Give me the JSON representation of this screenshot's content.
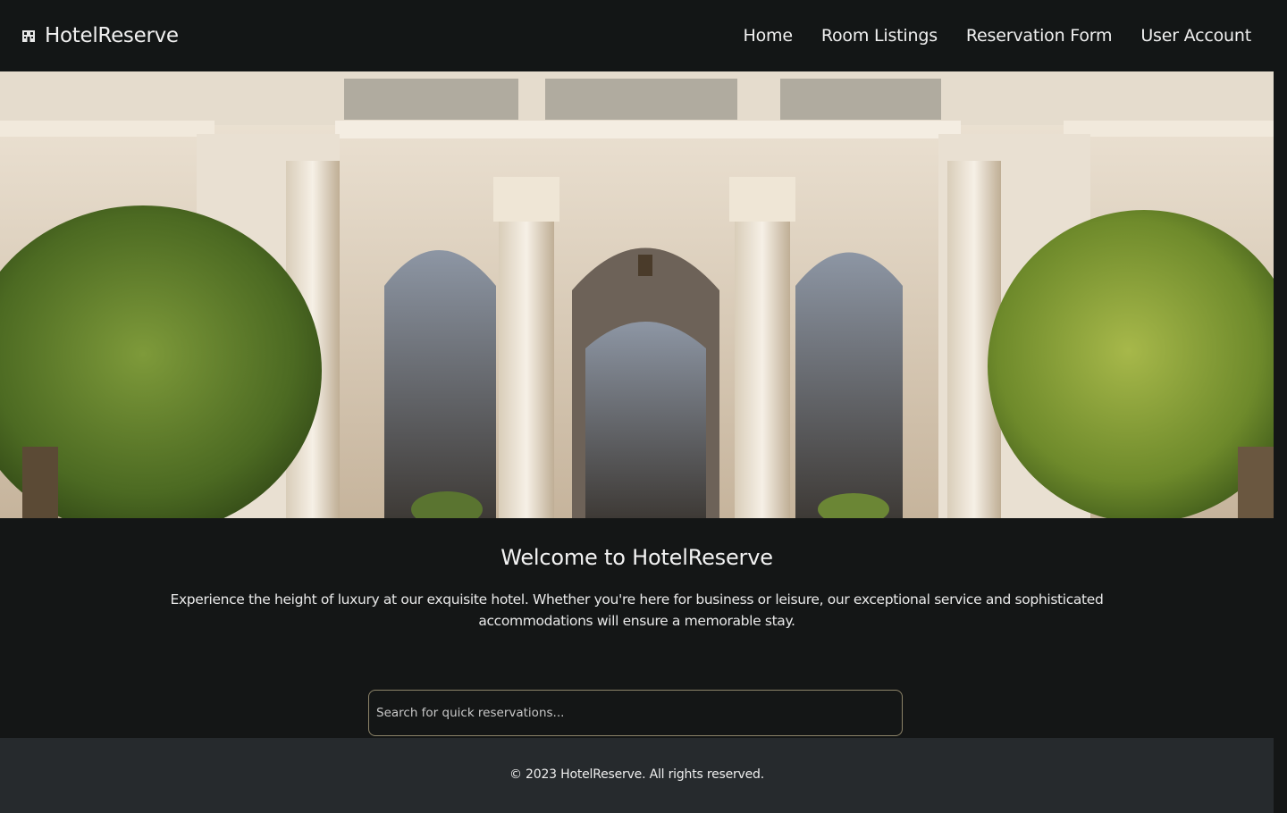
{
  "header": {
    "brand_name": "HotelReserve",
    "brand_icon": "hotel-icon",
    "nav": [
      {
        "label": "Home"
      },
      {
        "label": "Room Listings"
      },
      {
        "label": "Reservation Form"
      },
      {
        "label": "User Account"
      }
    ]
  },
  "hero": {
    "image": "hotel-entrance-photo"
  },
  "welcome": {
    "title": "Welcome to HotelReserve",
    "text": "Experience the height of luxury at our exquisite hotel. Whether you're here for business or leisure, our exceptional service and sophisticated accommodations will ensure a memorable stay."
  },
  "search": {
    "placeholder": "Search for quick reservations...",
    "value": ""
  },
  "footer": {
    "text": "© 2023 HotelReserve. All rights reserved."
  },
  "colors": {
    "background": "#141616",
    "footer": "#262a2d",
    "search_border": "#8d8469"
  }
}
